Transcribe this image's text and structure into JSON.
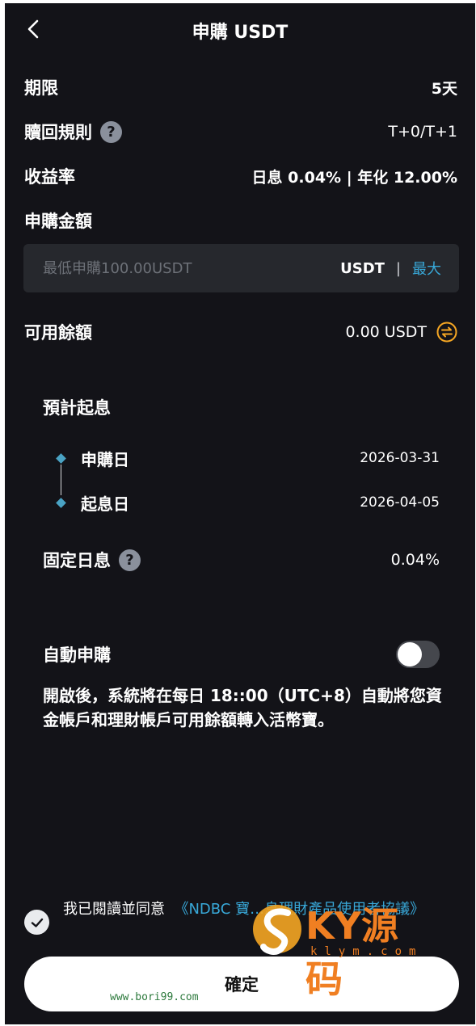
{
  "header": {
    "title": "申購 USDT"
  },
  "rows": {
    "term": {
      "label": "期限",
      "value": "5天"
    },
    "redeem": {
      "label": "贖回規則",
      "value": "T+0/T+1"
    },
    "rate": {
      "label": "收益率",
      "value": "日息 0.04% | 年化 12.00%"
    },
    "amount_label": "申購金額"
  },
  "amount": {
    "placeholder": "最低申購100.00USDT",
    "value": "",
    "unit": "USDT",
    "separator": "|",
    "max_label": "最大"
  },
  "available": {
    "label": "可用餘額",
    "value": "0.00 USDT"
  },
  "estimate": {
    "title": "預計起息",
    "timeline": [
      {
        "label": "申購日",
        "date": "2026-03-31"
      },
      {
        "label": "起息日",
        "date": "2026-04-05"
      }
    ],
    "fixed_daily_label": "固定日息",
    "fixed_daily_value": "0.04%"
  },
  "auto_subscribe": {
    "label": "自動申購",
    "enabled": false,
    "description": "開啟後，系統將在每日 18::00（UTC+8）自動將您資金帳戶和理財帳戶可用餘額轉入活幣寶。"
  },
  "agreement": {
    "checked": true,
    "text": "我已閱讀並同意",
    "link_text": "《NDBC 寶…息理財產品使用者協議》"
  },
  "confirm_label": "確定",
  "watermark": {
    "brand": "KY源码",
    "domain": "klym.com",
    "footer": "www.bori99.com"
  },
  "colors": {
    "background": "#131318",
    "accent": "#38a8d8",
    "exchange": "#f5a623",
    "input_bg": "#26282d"
  }
}
